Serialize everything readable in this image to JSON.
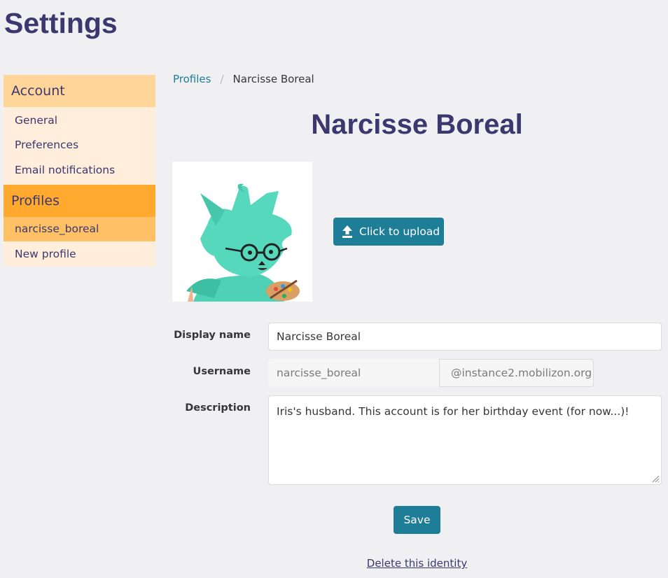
{
  "page": {
    "title": "Settings"
  },
  "sidebar": {
    "account": {
      "heading": "Account",
      "items": [
        {
          "label": "General"
        },
        {
          "label": "Preferences"
        },
        {
          "label": "Email notifications"
        }
      ]
    },
    "profiles": {
      "heading": "Profiles",
      "items": [
        {
          "label": "narcisse_boreal",
          "active": true
        },
        {
          "label": "New profile"
        }
      ]
    }
  },
  "breadcrumb": {
    "items": [
      {
        "label": "Profiles"
      },
      {
        "label": "Narcisse Boreal"
      }
    ],
    "separator": "/"
  },
  "profile": {
    "name": "Narcisse Boreal",
    "avatar_icon": "fox-painter-mascot",
    "upload_label": "Click to upload",
    "upload_icon": "upload-icon"
  },
  "form": {
    "display_name": {
      "label": "Display name",
      "value": "Narcisse Boreal"
    },
    "username": {
      "label": "Username",
      "value": "narcisse_boreal",
      "suffix": "@instance2.mobilizon.org"
    },
    "description": {
      "label": "Description",
      "value": "Iris's husband. This account is for her birthday event (for now...)!"
    },
    "save_label": "Save",
    "delete_label": "Delete this identity"
  },
  "colors": {
    "primary": "#1e7d97",
    "title": "#3c376e",
    "sidebar_account_head": "#ffd599",
    "sidebar_profiles_head": "#ffa92f",
    "sidebar_active": "#ffc066",
    "sidebar_bg": "#ffeedb"
  }
}
